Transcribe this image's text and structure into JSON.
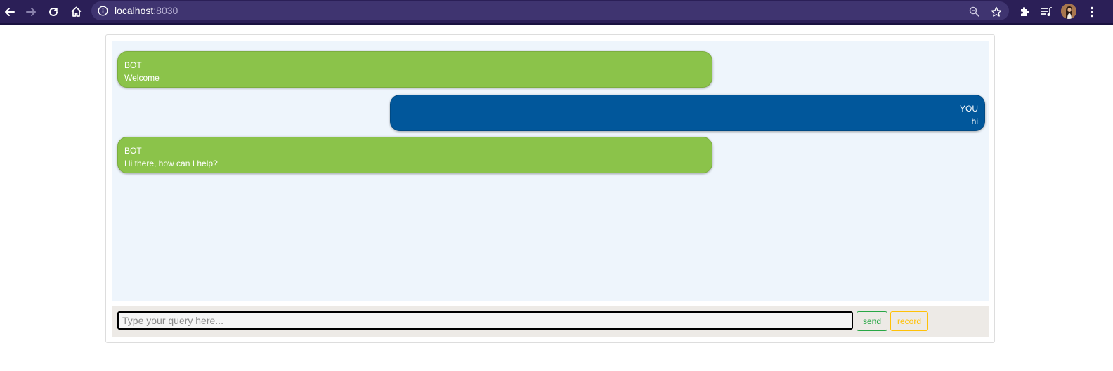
{
  "browser": {
    "url_host": "localhost",
    "url_port": ":8030"
  },
  "chat": {
    "messages": [
      {
        "sender": "BOT",
        "text": "Welcome"
      },
      {
        "sender": "YOU",
        "text": "hi"
      },
      {
        "sender": "BOT",
        "text": "Hi there, how can I help?"
      }
    ]
  },
  "composer": {
    "placeholder": "Type your query here...",
    "value": "",
    "send_label": "send",
    "record_label": "record"
  },
  "colors": {
    "toolbar": "#2b1f57",
    "bot_bubble": "#8bc34a",
    "user_bubble": "#01579b",
    "chat_background": "#eef5fc",
    "send_button": "#28a745",
    "record_button": "#ffc107"
  },
  "icons": [
    "back-icon",
    "forward-icon",
    "reload-icon",
    "home-icon",
    "info-icon",
    "zoom-icon",
    "bookmark-star-icon",
    "extensions-icon",
    "media-queue-icon",
    "profile-avatar",
    "menu-icon"
  ]
}
